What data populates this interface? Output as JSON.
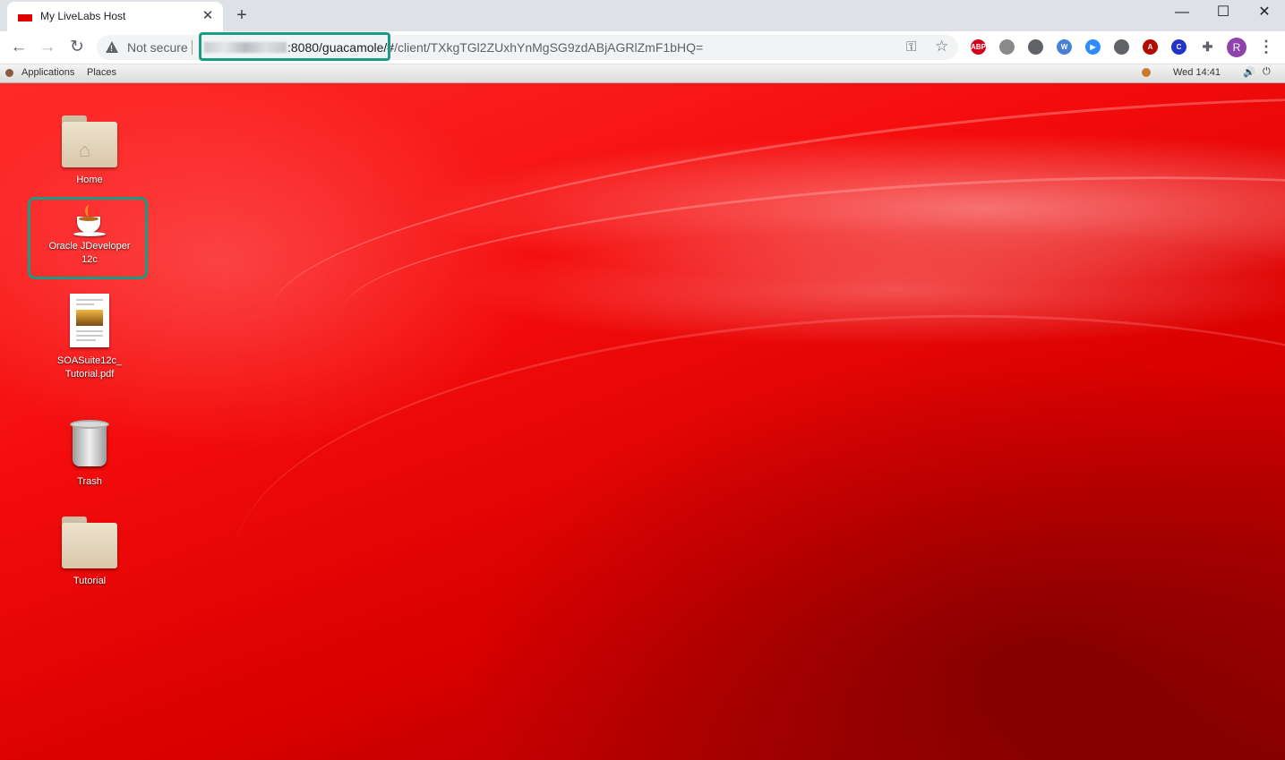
{
  "browser": {
    "tab_title": "My LiveLabs Host",
    "tab_close": "✕",
    "new_tab": "+",
    "window_controls": {
      "minimize": "—",
      "maximize": "☐",
      "close": "✕"
    },
    "toolbar": {
      "back": "←",
      "forward": "→",
      "reload": "↻"
    },
    "omnibox": {
      "security_label": "Not secure",
      "url_visible_part": ":8080/guacamole/#",
      "url_rest": "/client/TXkgTGl2ZUxhYnMgSG9zdABjAGRlZmF1bHQ="
    },
    "extensions": [
      {
        "name": "adblock-plus-icon",
        "label": "ABP",
        "color": "#d6001c"
      },
      {
        "name": "speech-bubble-icon",
        "label": "",
        "color": "#8a8a8a"
      },
      {
        "name": "circle-extension-icon",
        "label": "",
        "color": "#5f6368"
      },
      {
        "name": "w-extension-icon",
        "label": "W",
        "color": "#4a7fd8"
      },
      {
        "name": "zoom-icon",
        "label": "▶",
        "color": "#2d8cff"
      },
      {
        "name": "gear-extension-icon",
        "label": "",
        "color": "#5f6368"
      },
      {
        "name": "acrobat-icon",
        "label": "A",
        "color": "#b30b00"
      },
      {
        "name": "c-extension-icon",
        "label": "C",
        "color": "#2233cc"
      },
      {
        "name": "puzzle-icon",
        "label": "✚",
        "color": "#5f6368"
      }
    ],
    "profile_initial": "R"
  },
  "gnome": {
    "applications": "Applications",
    "places": "Places",
    "clock": "Wed 14:41",
    "volume_glyph": "🔊",
    "power_glyph": "⏻"
  },
  "desktop": {
    "icons": [
      {
        "label": "Home"
      },
      {
        "label_line1": "Oracle JDeveloper",
        "label_line2": "12c"
      },
      {
        "label_line1": "SOASuite12c_",
        "label_line2": "Tutorial.pdf"
      },
      {
        "label": "Trash"
      },
      {
        "label": "Tutorial"
      }
    ]
  },
  "colors": {
    "highlight": "#1a9c84",
    "desktop_red": "#e80000"
  }
}
